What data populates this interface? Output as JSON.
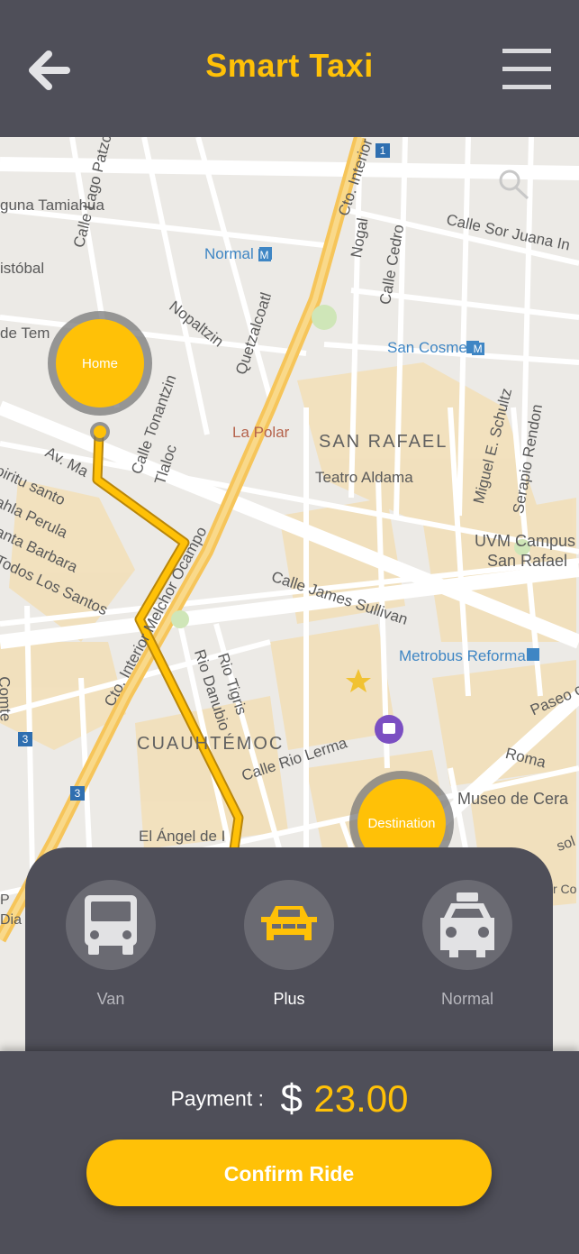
{
  "header": {
    "title": "Smart Taxi",
    "back_icon": "arrow-left-icon",
    "menu_icon": "hamburger-menu-icon"
  },
  "map": {
    "pins": {
      "origin_label": "Home",
      "destination_label": "Destination"
    },
    "labels": {
      "street_tamiahua": "guna Tamiahua",
      "street_cristobal": "istóbal",
      "street_templo": "de Tem",
      "street_patzcuaro": "Calle Lago Patzcuaro",
      "normal_station": "Normal",
      "nopaltzin": "Nopaltzin",
      "quetzalcoatl": "Quetzalcoatl",
      "nogal": "Nogal",
      "cedro": "Calle Cedro",
      "cto_interior": "Cto. Interior",
      "sor_juana": "Calle Sor Juana In",
      "san_cosme": "San Cosme",
      "tonantzin": "Calle Tonantzin",
      "tlaloc": "Tlaloc",
      "la_polar": "La Polar",
      "san_rafael": "SAN RAFAEL",
      "teatro": "Teatro Aldama",
      "schultz": "Miguel E. Schultz",
      "serapio": "Serapio Rendon",
      "uvm": "UVM Campus",
      "uvm2": "San Rafael",
      "av_ma": "Av. Ma",
      "espiritu": "piritu santo",
      "perula": "ahla Perula",
      "barbara": "anta Barbara",
      "santos": "Todos Los Santos",
      "james_sullivan": "Calle James Sullivan",
      "metrobus": "Metrobus Reforma",
      "ocampo": "Cto. Interior Melchor Ocampo",
      "rio_tigris": "Rio Tigris",
      "rio_danubio": "Rio Danubio",
      "comte": "Comte",
      "cuauhtemoc": "CUAUHTÉMOC",
      "rio_lerma": "Calle Rio Lerma",
      "paseo": "Paseo c",
      "roma": "Roma",
      "museo": "Museo de Cera",
      "angel": "El Ángel de I",
      "p_label": "P",
      "dia_label": "Dia",
      "sol_label": "sol",
      "co_label": "r Co",
      "badge_1": "1",
      "badge_3a": "3",
      "badge_3b": "3",
      "metro_m": "M"
    }
  },
  "ride_options": [
    {
      "label": "Van",
      "icon": "bus-icon",
      "active": false
    },
    {
      "label": "Plus",
      "icon": "car-icon",
      "active": true
    },
    {
      "label": "Normal",
      "icon": "taxi-icon",
      "active": false
    }
  ],
  "payment": {
    "label": "Payment :",
    "currency": "$",
    "amount": "23.00"
  },
  "confirm_button": {
    "label": "Confirm Ride"
  },
  "colors": {
    "accent": "#ffc107",
    "background": "#4f4f59",
    "map_bg": "#eceae6",
    "route": "#ffc107"
  }
}
